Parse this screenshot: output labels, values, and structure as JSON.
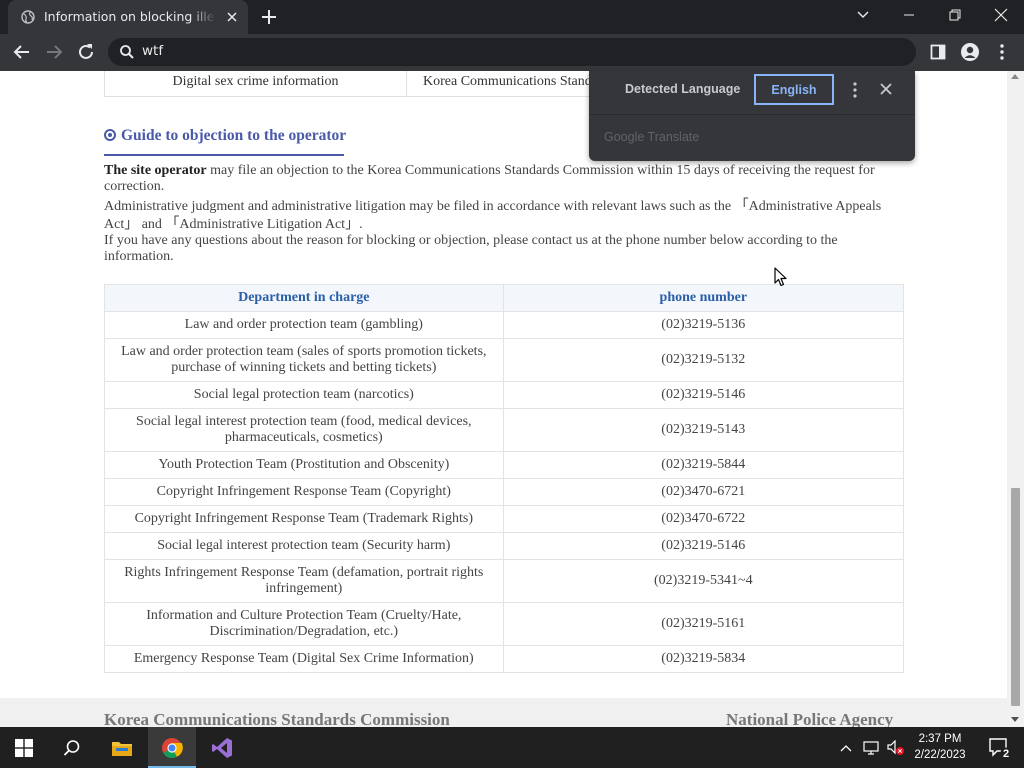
{
  "browser": {
    "tab_title": "Information on blocking illegal and harmful information",
    "address": "wtf"
  },
  "translate_popup": {
    "detected_label": "Detected Language",
    "target_label": "English",
    "brand": "Google Translate"
  },
  "page": {
    "top_row": {
      "left": "Digital sex crime information",
      "right": "Korea Communications Standards Commission"
    },
    "guide_title": "Guide to objection to the operator",
    "paragraphs": {
      "p1_bold": "The site operator",
      "p1_rest": " may file an objection to the Korea Communications Standards Commission within 15 days of receiving the request for correction.",
      "p2": "Administrative judgment and administrative litigation may be filed in accordance with relevant laws such as the 「Administrative Appeals Act」 and 「Administrative Litigation Act」.",
      "p3": "If you have any questions about the reason for blocking or objection, please contact us at the phone number below according to the information."
    },
    "table": {
      "headers": [
        "Department in charge",
        "phone number"
      ],
      "rows": [
        {
          "dept": "Law and order protection team (gambling)",
          "phone": "(02)3219-5136"
        },
        {
          "dept": "Law and order protection team (sales of sports promotion tickets, purchase of winning tickets and betting tickets)",
          "phone": "(02)3219-5132"
        },
        {
          "dept": "Social legal protection team (narcotics)",
          "phone": "(02)3219-5146"
        },
        {
          "dept": "Social legal interest protection team (food, medical devices, pharmaceuticals, cosmetics)",
          "phone": "(02)3219-5143"
        },
        {
          "dept": "Youth Protection Team (Prostitution and Obscenity)",
          "phone": "(02)3219-5844"
        },
        {
          "dept": "Copyright Infringement Response Team (Copyright)",
          "phone": "(02)3470-6721"
        },
        {
          "dept": "Copyright Infringement Response Team (Trademark Rights)",
          "phone": "(02)3470-6722"
        },
        {
          "dept": "Social legal interest protection team (Security harm)",
          "phone": "(02)3219-5146"
        },
        {
          "dept": "Rights Infringement Response Team (defamation, portrait rights infringement)",
          "phone": "(02)3219-5341~4"
        },
        {
          "dept": "Information and Culture Protection Team (Cruelty/Hate, Discrimination/Degradation, etc.)",
          "phone": "(02)3219-5161"
        },
        {
          "dept": "Emergency Response Team (Digital Sex Crime Information)",
          "phone": "(02)3219-5834"
        }
      ]
    },
    "footer": {
      "left": "Korea Communications Standards Commission",
      "right": "National Police Agency"
    }
  },
  "taskbar": {
    "time": "2:37 PM",
    "date": "2/22/2023",
    "notification_count": "2"
  },
  "colors": {
    "accent_title": "#4a5aa8",
    "table_header_text": "#2a5fa8",
    "translate_selected": "#8ab4f8"
  }
}
